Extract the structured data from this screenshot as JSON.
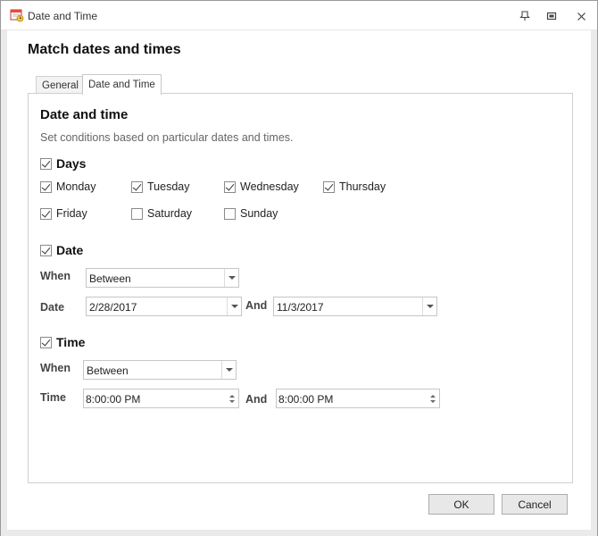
{
  "window": {
    "title": "Date and Time"
  },
  "heading": "Match dates and times",
  "tabs": [
    {
      "label": "General"
    },
    {
      "label": "Date and Time"
    }
  ],
  "panel": {
    "title": "Date and time",
    "subtitle": "Set conditions based on particular dates and times."
  },
  "days": {
    "label": "Days",
    "checked": true,
    "items": [
      {
        "label": "Monday",
        "checked": true
      },
      {
        "label": "Tuesday",
        "checked": true
      },
      {
        "label": "Wednesday",
        "checked": true
      },
      {
        "label": "Thursday",
        "checked": true
      },
      {
        "label": "Friday",
        "checked": true
      },
      {
        "label": "Saturday",
        "checked": false
      },
      {
        "label": "Sunday",
        "checked": false
      }
    ]
  },
  "date": {
    "label": "Date",
    "checked": true,
    "when_label": "When",
    "when_value": "Between",
    "date_label": "Date",
    "from": "2/28/2017",
    "and_label": "And",
    "to": "11/3/2017"
  },
  "time": {
    "label": "Time",
    "checked": true,
    "when_label": "When",
    "when_value": "Between",
    "time_label": "Time",
    "from": "8:00:00 PM",
    "and_label": "And",
    "to": "8:00:00 PM"
  },
  "buttons": {
    "ok": "OK",
    "cancel": "Cancel"
  },
  "icons": {
    "app": "calendar-clock-icon",
    "pin": "pin-icon",
    "maximize": "maximize-icon",
    "close": "close-icon"
  }
}
